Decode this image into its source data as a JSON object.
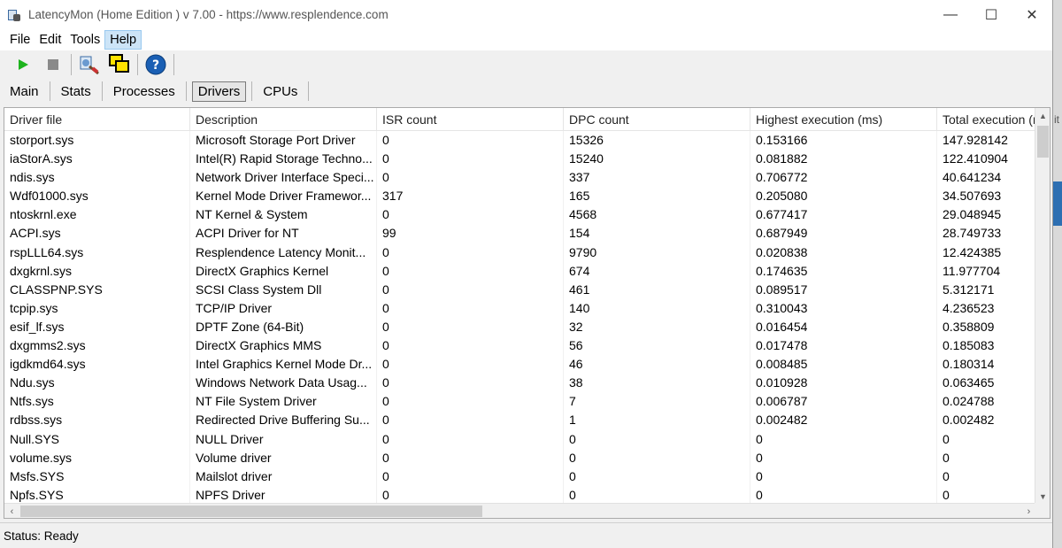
{
  "window": {
    "title": "LatencyMon  (Home Edition )  v 7.00 - https://www.resplendence.com",
    "minimize": "—",
    "maximize": "☐",
    "close": "✕"
  },
  "menu": [
    {
      "label": "File"
    },
    {
      "label": "Edit"
    },
    {
      "label": "Tools"
    },
    {
      "label": "Help"
    }
  ],
  "toolbar": {
    "icons": [
      "play-icon",
      "stop-icon",
      "cleanup-icon",
      "windows-icon",
      "help-icon"
    ],
    "colors": {
      "play": "#1db31d",
      "stop": "#808080",
      "help": "#1a5fb4"
    }
  },
  "tabs": [
    {
      "label": "Main"
    },
    {
      "label": "Stats"
    },
    {
      "label": "Processes"
    },
    {
      "label": "Drivers"
    },
    {
      "label": "CPUs"
    }
  ],
  "table": {
    "columns": [
      "Driver file",
      "Description",
      "ISR count",
      "DPC count",
      "Highest execution (ms)",
      "Total execution (m"
    ],
    "rows": [
      [
        "storport.sys",
        "Microsoft Storage Port Driver",
        "0",
        "15326",
        "0.153166",
        "147.928142"
      ],
      [
        "iaStorA.sys",
        "Intel(R) Rapid Storage Techno...",
        "0",
        "15240",
        "0.081882",
        "122.410904"
      ],
      [
        "ndis.sys",
        "Network Driver Interface Speci...",
        "0",
        "337",
        "0.706772",
        "40.641234"
      ],
      [
        "Wdf01000.sys",
        "Kernel Mode Driver Framewor...",
        "317",
        "165",
        "0.205080",
        "34.507693"
      ],
      [
        "ntoskrnl.exe",
        "NT Kernel & System",
        "0",
        "4568",
        "0.677417",
        "29.048945"
      ],
      [
        "ACPI.sys",
        "ACPI Driver for NT",
        "99",
        "154",
        "0.687949",
        "28.749733"
      ],
      [
        "rspLLL64.sys",
        "Resplendence Latency Monit...",
        "0",
        "9790",
        "0.020838",
        "12.424385"
      ],
      [
        "dxgkrnl.sys",
        "DirectX Graphics Kernel",
        "0",
        "674",
        "0.174635",
        "11.977704"
      ],
      [
        "CLASSPNP.SYS",
        "SCSI Class System Dll",
        "0",
        "461",
        "0.089517",
        "5.312171"
      ],
      [
        "tcpip.sys",
        "TCP/IP Driver",
        "0",
        "140",
        "0.310043",
        "4.236523"
      ],
      [
        "esif_lf.sys",
        "DPTF Zone (64-Bit)",
        "0",
        "32",
        "0.016454",
        "0.358809"
      ],
      [
        "dxgmms2.sys",
        "DirectX Graphics MMS",
        "0",
        "56",
        "0.017478",
        "0.185083"
      ],
      [
        "igdkmd64.sys",
        "Intel Graphics Kernel Mode Dr...",
        "0",
        "46",
        "0.008485",
        "0.180314"
      ],
      [
        "Ndu.sys",
        "Windows Network Data Usag...",
        "0",
        "38",
        "0.010928",
        "0.063465"
      ],
      [
        "Ntfs.sys",
        "NT File System Driver",
        "0",
        "7",
        "0.006787",
        "0.024788"
      ],
      [
        "rdbss.sys",
        "Redirected Drive Buffering Su...",
        "0",
        "1",
        "0.002482",
        "0.002482"
      ],
      [
        "Null.SYS",
        "NULL Driver",
        "0",
        "0",
        "0",
        "0"
      ],
      [
        "volume.sys",
        "Volume driver",
        "0",
        "0",
        "0",
        "0"
      ],
      [
        "Msfs.SYS",
        "Mailslot driver",
        "0",
        "0",
        "0",
        "0"
      ],
      [
        "Npfs.SYS",
        "NPFS Driver",
        "0",
        "0",
        "0",
        "0"
      ]
    ]
  },
  "status": {
    "text": "Status: Ready"
  },
  "side": {
    "text": "it"
  }
}
